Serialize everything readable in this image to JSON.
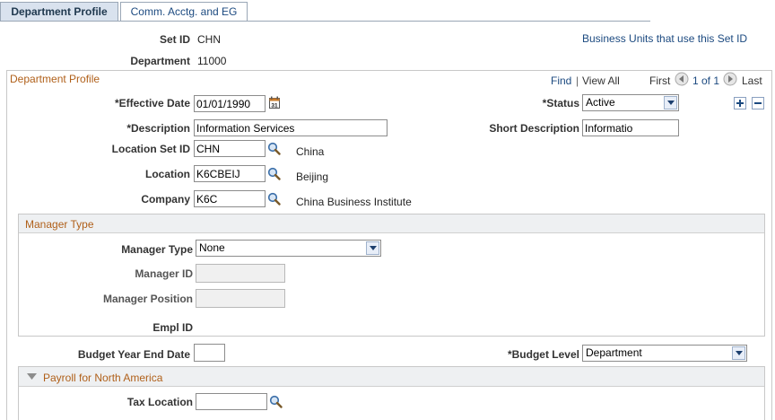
{
  "tabs": [
    {
      "label": "Department Profile",
      "active": true
    },
    {
      "label": "Comm. Acctg. and EG",
      "active": false
    }
  ],
  "header": {
    "setid_label": "Set ID",
    "setid_value": "CHN",
    "department_label": "Department",
    "department_value": "11000",
    "business_units_link": "Business Units that use this Set ID"
  },
  "profile": {
    "title": "Department Profile",
    "find": "Find",
    "sep": "|",
    "view_all": "View All",
    "first": "First",
    "page_count": "1 of 1",
    "last": "Last",
    "effective_date_label": "Effective Date",
    "effective_date_value": "01/01/1990",
    "status_label": "Status",
    "status_value": "Active",
    "description_label": "Description",
    "description_value": "Information Services",
    "short_description_label": "Short Description",
    "short_description_value": "Informatio",
    "location_setid_label": "Location Set ID",
    "location_setid_value": "CHN",
    "location_setid_desc": "China",
    "location_label": "Location",
    "location_value": "K6CBEIJ",
    "location_desc": "Beijing",
    "company_label": "Company",
    "company_value": "K6C",
    "company_desc": "China Business Institute",
    "required_mark": "*"
  },
  "manager": {
    "title": "Manager Type",
    "type_label": "Manager Type",
    "type_value": "None",
    "id_label": "Manager ID",
    "id_value": "",
    "position_label": "Manager Position",
    "position_value": "",
    "emplid_label": "Empl ID"
  },
  "budget": {
    "year_end_label": "Budget Year End Date",
    "year_end_value": "",
    "level_label": "Budget Level",
    "level_value": "Department"
  },
  "payroll": {
    "title": "Payroll for North America",
    "tax_location_label": "Tax Location",
    "tax_location_value": ""
  },
  "colors": {
    "accent": "#b0601a",
    "link": "#1c4a80"
  }
}
